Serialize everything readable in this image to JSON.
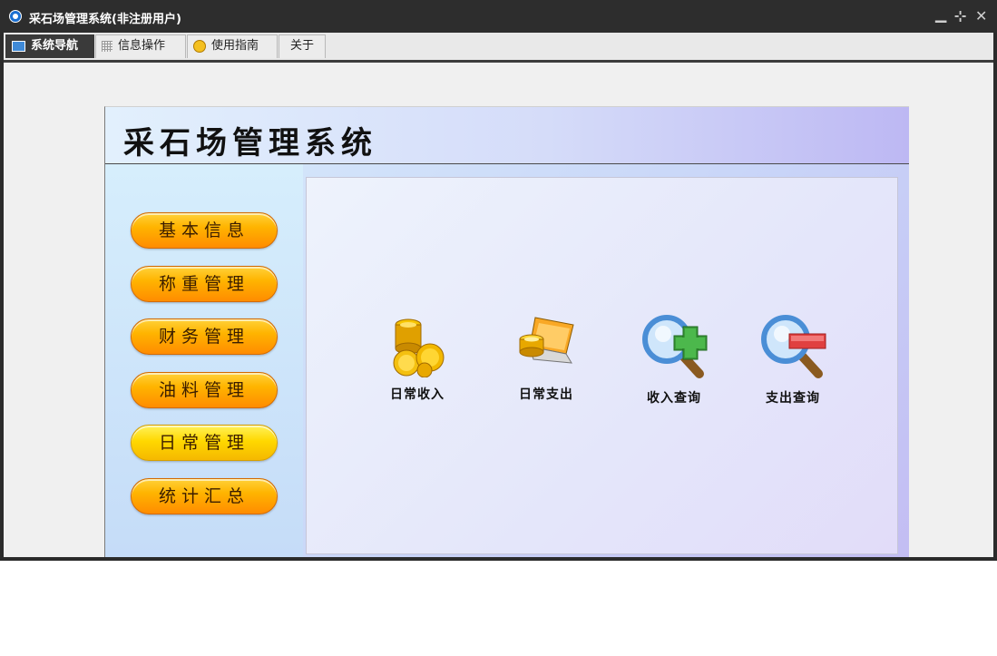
{
  "window": {
    "title": "采石场管理系统(非注册用户)",
    "controls": {
      "minimize": "▁",
      "restore": "⊹",
      "close": "✕"
    }
  },
  "menu": {
    "tabs": [
      {
        "label": "系统导航",
        "icon": "monitor-icon",
        "active": true
      },
      {
        "label": "信息操作",
        "icon": "grid-icon",
        "active": false
      },
      {
        "label": "使用指南",
        "icon": "smile-icon",
        "active": false
      },
      {
        "label": "关于",
        "icon": "",
        "active": false
      }
    ]
  },
  "main": {
    "system_title": "采石场管理系统",
    "nav_buttons": [
      {
        "label": "基本信息"
      },
      {
        "label": "称重管理"
      },
      {
        "label": "财务管理"
      },
      {
        "label": "油料管理"
      },
      {
        "label": "日常管理",
        "highlighted": true
      },
      {
        "label": "统计汇总"
      }
    ],
    "functions": [
      {
        "label": "日常收入",
        "icon": "gold-coins-icon"
      },
      {
        "label": "日常支出",
        "icon": "laptop-coins-icon"
      },
      {
        "label": "收入查询",
        "icon": "magnifier-plus-icon"
      },
      {
        "label": "支出查询",
        "icon": "magnifier-minus-icon"
      }
    ]
  },
  "colors": {
    "titlebar": "#2d2d2d",
    "nav_button_orange": "#ff9a00",
    "nav_button_highlight": "#ffd800",
    "accent_green": "#3a9a3a",
    "accent_red": "#e04040"
  }
}
